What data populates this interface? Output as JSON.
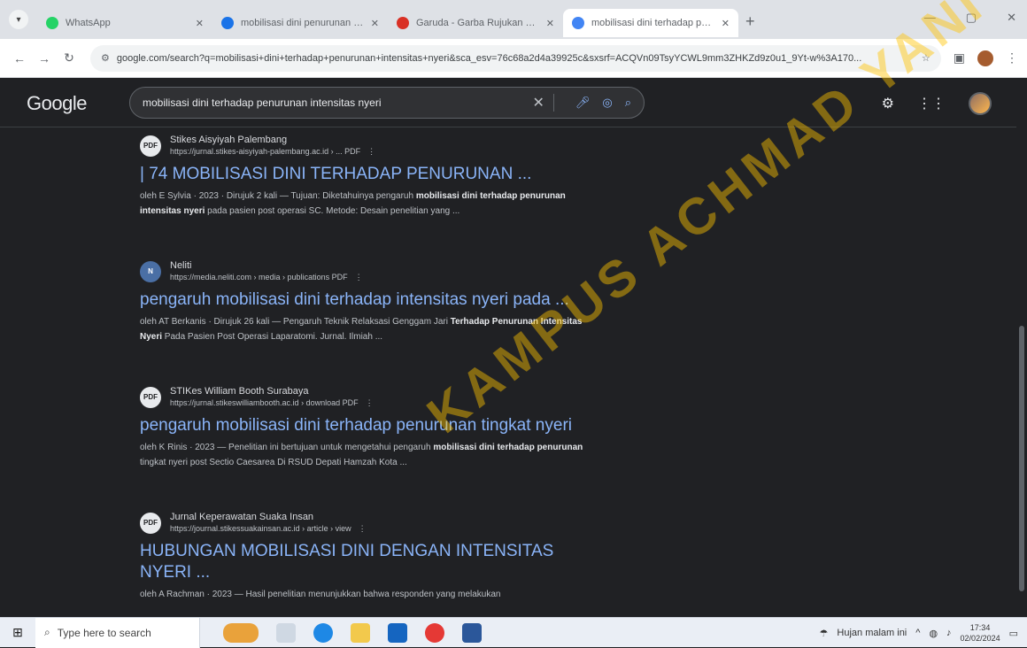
{
  "browser": {
    "tabs": [
      {
        "title": "WhatsApp",
        "color": "#25D366"
      },
      {
        "title": "mobilisasi dini penurunan nyeri",
        "color": "#1a73e8"
      },
      {
        "title": "Garuda - Garba Rujukan Digital",
        "color": "#d93025"
      },
      {
        "title": "mobilisasi dini terhadap penurunan",
        "color": "#4285f4"
      }
    ],
    "address": "google.com/search?q=mobilisasi+dini+terhadap+penurunan+intensitas+nyeri&sca_esv=76c68a2d4a39925c&sxsrf=ACQVn09TsyYCWL9mm3ZHKZd9z0u1_9Yt-w%3A170..."
  },
  "google": {
    "logo": "Google",
    "query": "mobilisasi dini terhadap penurunan intensitas nyeri"
  },
  "results": [
    {
      "icon_label": "PDF",
      "source": "Stikes Aisyiyah Palembang",
      "url": "https://jurnal.stikes-aisyiyah-palembang.ac.id › ... PDF",
      "title": "| 74 MOBILISASI DINI TERHADAP PENURUNAN ...",
      "snippet_pre": "oleh E Sylvia · 2023 · Dirujuk 2 kali — Tujuan: Diketahuinya pengaruh ",
      "snippet_bold": "mobilisasi dini terhadap penurunan intensitas nyeri",
      "snippet_post": " pada pasien post operasi SC. Metode: Desain penelitian yang ..."
    },
    {
      "icon_label": "N",
      "source": "Neliti",
      "url": "https://media.neliti.com › media › publications PDF",
      "title": "pengaruh mobilisasi dini terhadap intensitas nyeri pada ...",
      "snippet_pre": "oleh AT Berkanis · Dirujuk 26 kali — Pengaruh Teknik Relaksasi Genggam Jari ",
      "snippet_bold": "Terhadap Penurunan Intensitas Nyeri",
      "snippet_post": " Pada Pasien Post Operasi Laparatomi. Jurnal. Ilmiah ..."
    },
    {
      "icon_label": "PDF",
      "source": "STIKes William Booth Surabaya",
      "url": "https://jurnal.stikeswilliambooth.ac.id › download PDF",
      "title": "pengaruh mobilisasi dini terhadap penurunan tingkat nyeri",
      "snippet_pre": "oleh K Rinis · 2023 — Penelitian ini bertujuan untuk mengetahui pengaruh ",
      "snippet_bold": "mobilisasi dini terhadap penurunan",
      "snippet_post": " tingkat nyeri post Sectio Caesarea Di RSUD Depati Hamzah Kota ..."
    },
    {
      "icon_label": "PDF",
      "source": "Jurnal Keperawatan Suaka Insan",
      "url": "https://journal.stikessuakainsan.ac.id › article › view",
      "title": "HUBUNGAN MOBILISASI DINI DENGAN INTENSITAS NYERI ...",
      "snippet_pre": "oleh A Rachman · 2023 — Hasil penelitian menunjukkan bahwa responden yang melakukan",
      "snippet_bold": "",
      "snippet_post": ""
    }
  ],
  "watermark": "KAMPUS ACHMAD YANI",
  "taskbar": {
    "search_placeholder": "Type here to search",
    "weather": "Hujan malam ini",
    "time": "17:34",
    "date": "02/02/2024"
  }
}
